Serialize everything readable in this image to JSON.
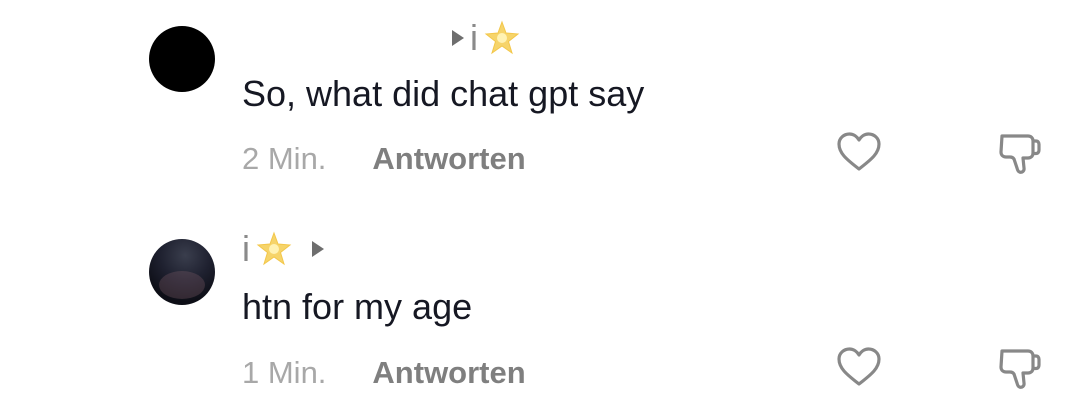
{
  "comments": [
    {
      "username": "i",
      "badge_icon": "sparkle-star-icon",
      "reply_arrow_icon": "triangle-right-icon",
      "text": "So, what did chat gpt say",
      "time": "2 Min.",
      "reply_label": "Antworten",
      "like_icon": "heart-outline-icon",
      "dislike_icon": "thumbs-down-outline-icon"
    },
    {
      "username": "i",
      "badge_icon": "sparkle-star-icon",
      "reply_arrow_icon": "triangle-right-icon",
      "text": "htn for my age",
      "time": "1 Min.",
      "reply_label": "Antworten",
      "like_icon": "heart-outline-icon",
      "dislike_icon": "thumbs-down-outline-icon"
    }
  ],
  "colors": {
    "text": "#161823",
    "meta_time": "#a8a8a8",
    "reply": "#7f7f7f",
    "icon_stroke": "#888888",
    "star": "#f6d46a"
  }
}
